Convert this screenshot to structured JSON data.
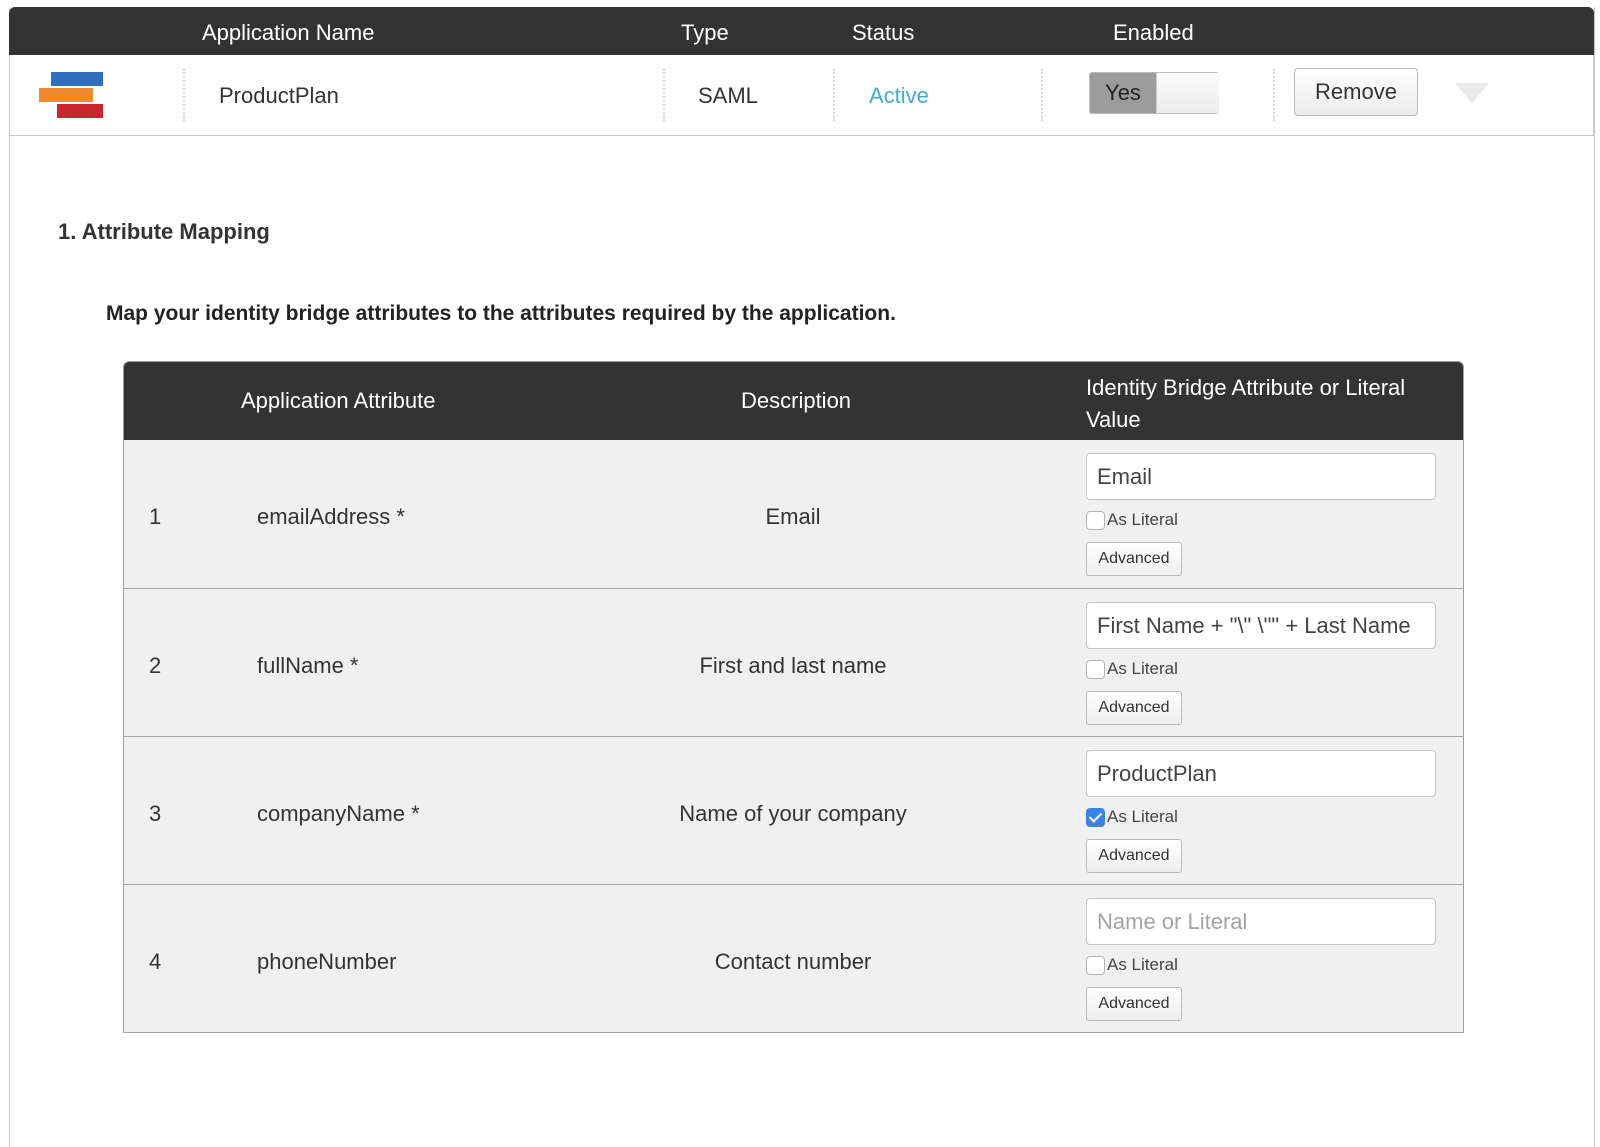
{
  "app_header": {
    "col_name": "Application Name",
    "col_type": "Type",
    "col_status": "Status",
    "col_enabled": "Enabled"
  },
  "app_row": {
    "logo": "productplan-logo",
    "name": "ProductPlan",
    "type": "SAML",
    "status": "Active",
    "enabled_label": "Yes",
    "enabled": true,
    "remove_label": "Remove",
    "expand_icon": "chevron-down-icon"
  },
  "section": {
    "title": "1. Attribute Mapping",
    "instructions": "Map your identity bridge attributes to the attributes required by the application."
  },
  "mapping": {
    "headers": {
      "attribute": "Application Attribute",
      "description": "Description",
      "value": "Identity Bridge Attribute or Literal Value"
    },
    "rows": [
      {
        "num": "1",
        "attribute": "emailAddress *",
        "description": "Email",
        "value": "Email",
        "placeholder": "Name or Literal",
        "literal_label": "As Literal",
        "as_literal": false,
        "advanced_label": "Advanced"
      },
      {
        "num": "2",
        "attribute": "fullName *",
        "description": "First and last name",
        "value": "First Name + \"\\\" \\\"\" + Last Name",
        "placeholder": "Name or Literal",
        "literal_label": "As Literal",
        "as_literal": false,
        "advanced_label": "Advanced"
      },
      {
        "num": "3",
        "attribute": "companyName *",
        "description": "Name of your company",
        "value": "ProductPlan",
        "placeholder": "Name or Literal",
        "literal_label": "As Literal",
        "as_literal": true,
        "advanced_label": "Advanced"
      },
      {
        "num": "4",
        "attribute": "phoneNumber",
        "description": "Contact number",
        "value": "",
        "placeholder": "Name or Literal",
        "literal_label": "As Literal",
        "as_literal": false,
        "advanced_label": "Advanced"
      }
    ]
  },
  "colors": {
    "header_bg": "#333333",
    "status_active": "#41aec4",
    "logo_blue": "#2f6fbf",
    "logo_orange": "#ef8a2e",
    "logo_red": "#c9252b",
    "checkbox_checked": "#3b82e6"
  }
}
